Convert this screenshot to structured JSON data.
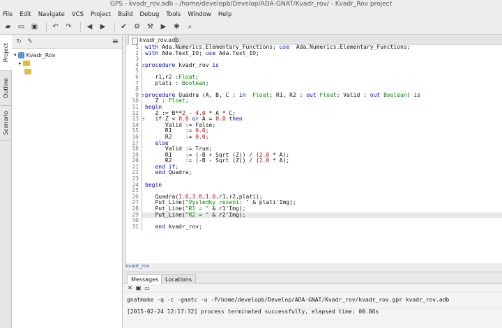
{
  "window": {
    "title": "GPS - kvadr_rov.adb - /home/developb/Develop/ADA-GNAT/Kvadr_rov/ - Kvadr_Rov project"
  },
  "menu": [
    "File",
    "Edit",
    "Navigate",
    "VCS",
    "Project",
    "Build",
    "Debug",
    "Tools",
    "Window",
    "Help"
  ],
  "toolbar": {
    "icons": [
      "folder-open-icon",
      "folder-icon",
      "save-icon",
      "undo-icon",
      "redo-icon",
      "back-icon",
      "forward-icon",
      "check-icon",
      "compile-icon",
      "build-icon",
      "run-icon",
      "debug-icon",
      "search-icon"
    ]
  },
  "side_tabs": [
    "Project",
    "Outline",
    "Scenario"
  ],
  "project": {
    "root": "Kvadr_Rov",
    "children": [
      "",
      ""
    ]
  },
  "editor": {
    "tab": "kvadr_rov.adb",
    "file_label": "kvadr_rov",
    "line_numbers": [
      "1",
      "2",
      "3",
      "4",
      "5",
      "6",
      "7",
      "8",
      "9",
      "10",
      "11",
      "12",
      "13",
      "14",
      "15",
      "16",
      "17",
      "18",
      "19",
      "20",
      "21",
      "22",
      "23",
      "24",
      "25",
      "26",
      "27",
      "28",
      "29",
      "30",
      "31"
    ],
    "lines": [
      "with Ada.Numerics.Elementary_Functions; use  Ada.Numerics.Elementary_Functions;",
      "with Ada.Text_IO; use Ada.Text_IO;",
      "",
      "procedure kvadr_rov is",
      "",
      "   r1,r2 :Float;",
      "   plati : Boolean;",
      "",
      "procedure Quadra (A, B, C : in  Float; R1, R2 : out Float; Valid : out Boolean) is",
      "   Z : Float;",
      "begin",
      "   Z := B**2 - 4.0 * A * C;",
      "   if Z < 0.0 or A = 0.0 then",
      "      Valid := False;",
      "      R1    := 0.0;",
      "      R2    := 0.0;",
      "   else",
      "      Valid := True;",
      "      R1    := (-B + Sqrt (Z)) / (2.0 * A);",
      "      R2    := (-B - Sqrt (Z)) / (2.0 * A);",
      "   end if;",
      "   end Quadra;",
      "",
      "begin",
      "",
      "   Quadra(1.0,3.0,1.0,r1,r2,plati);",
      "   Put_Line(\"Vysledky reseni: \" & plati'Img);",
      "   Put_Line(\"R1 = \" & r1'Img);",
      "   Put_Line(\"R2 = \" & r2'Img);",
      "",
      "   end kvadr_rov;"
    ]
  },
  "messages": {
    "tabs": [
      "Messages",
      "Locations"
    ],
    "lines": [
      "gnatmake -q -c -gnatc -u -P/home/developb/Develop/ADA-GNAT/Kvadr_rov/kvadr_rov.gpr kvadr_rov.adb",
      "[2015-02-24 12:17:32] process terminated successfully, elapsed time: 00.86s"
    ]
  }
}
